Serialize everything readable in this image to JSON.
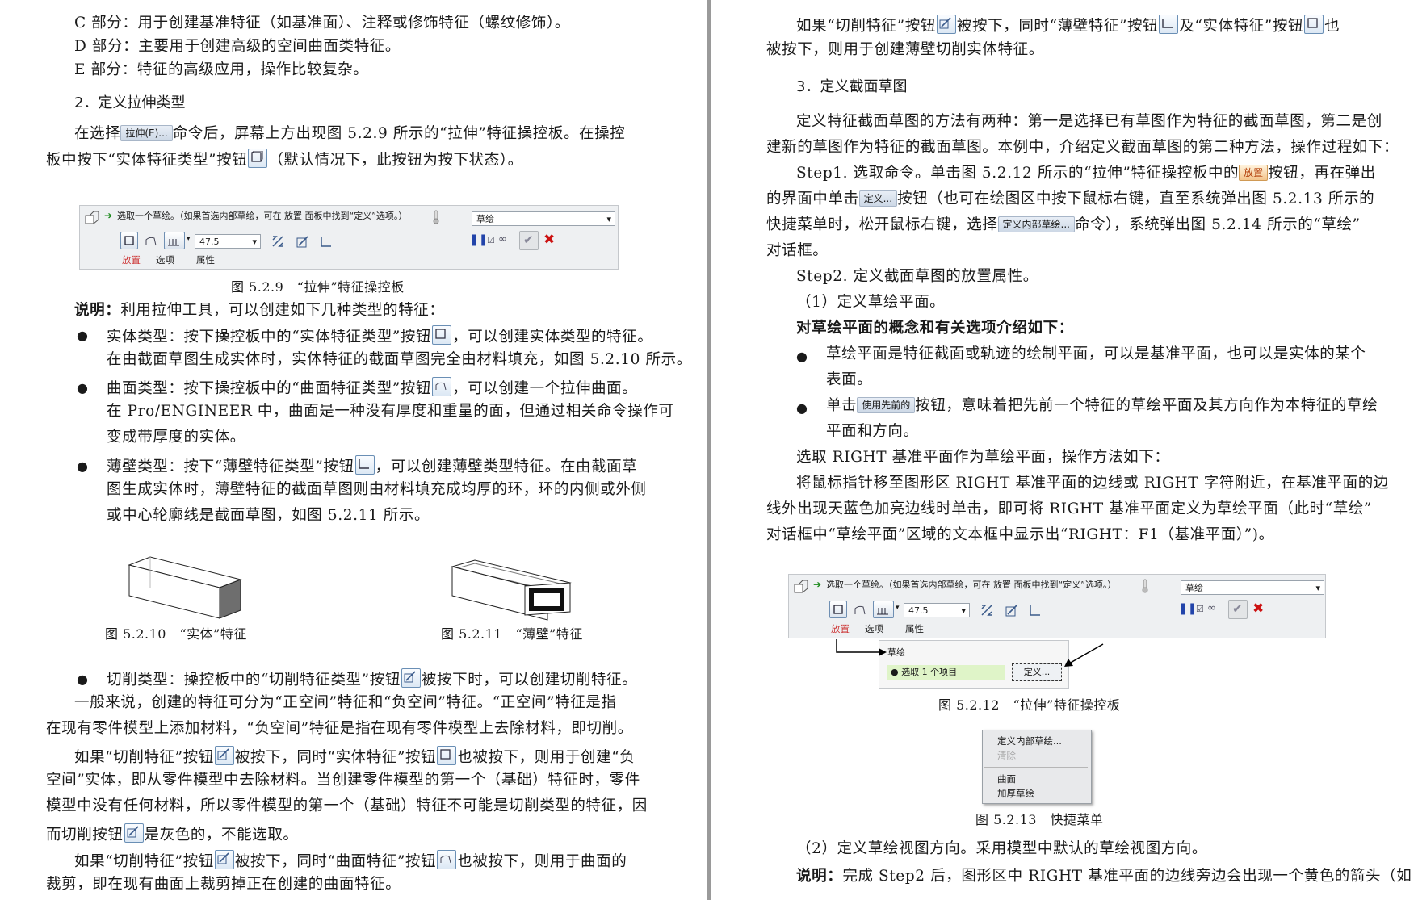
{
  "left": {
    "lines": [
      "C 部分：用于创建基准特征（如基准面）、注释或修饰特征（螺纹修饰）。",
      "D 部分：主要用于创建高级的空间曲面类特征。",
      "E 部分：特征的高级应用，操作比较复杂。"
    ],
    "heading2": "2．定义拉伸类型",
    "p1a_pre": "在选择",
    "p1a_btn": "拉伸(E)...",
    "p1a_post": "命令后，屏幕上方出现图 5.2.9 所示的“拉伸”特征操控板。在操控",
    "p1b_pre": "板中按下“实体特征类型”按钮",
    "p1b_post": "（默认情况下，此按钮为按下状态）。",
    "toolbar1": {
      "msg": "选取一个草绘。（如果首选内部草绘，可在 放置 面板中找到“定义”选项。）",
      "combo_right": "草绘",
      "depth": "47.5",
      "tab_place": "放置",
      "tab_options": "选项",
      "tab_props": "属性"
    },
    "cap529": "图 5.2.9　“拉伸”特征操控板",
    "note_label": "说明：",
    "note_text": "利用拉伸工具，可以创建如下几种类型的特征：",
    "b1a_pre": "实体类型：按下操控板中的“实体特征类型”按钮",
    "b1a_post": "，可以创建实体类型的特征。",
    "b1b": "在由截面草图生成实体时，实体特征的截面草图完全由材料填充，如图 5.2.10 所示。",
    "b2a_pre": "曲面类型：按下操控板中的“曲面特征类型”按钮",
    "b2a_post": "，可以创建一个拉伸曲面。",
    "b2b": "在 Pro/ENGINEER 中，曲面是一种没有厚度和重量的面，但通过相关命令操作可",
    "b2c": "变成带厚度的实体。",
    "b3a_pre": "薄壁类型：按下“薄壁特征类型”按钮",
    "b3a_post": "，可以创建薄壁类型特征。在由截面草",
    "b3b": "图生成实体时，薄壁特征的截面草图则由材料填充成均厚的环，环的内侧或外侧",
    "b3c": "或中心轮廓线是截面草图，如图 5.2.11 所示。",
    "cap5210": "图 5.2.10　“实体”特征",
    "cap5211": "图 5.2.11　“薄壁”特征",
    "b4_pre": "切削类型：操控板中的“切削特征类型”按钮",
    "b4_post": "被按下时，可以创建切削特征。",
    "p2a": "一般来说，创建的特征可分为“正空间”特征和“负空间”特征。“正空间”特征是指",
    "p2b": "在现有零件模型上添加材料，“负空间”特征是指在现有零件模型上去除材料，即切削。",
    "p3a_pre": "如果“切削特征”按钮",
    "p3a_mid": "被按下，同时“实体特征”按钮",
    "p3a_post": "也被按下，则用于创建“负",
    "p3b": "空间”实体，即从零件模型中去除材料。当创建零件模型的第一个（基础）特征时，零件",
    "p3c": "模型中没有任何材料，所以零件模型的第一个（基础）特征不可能是切削类型的特征，因",
    "p3d_pre": "而切削按钮",
    "p3d_post": "是灰色的，不能选取。",
    "p4a_pre": "如果“切削特征”按钮",
    "p4a_mid": "被按下，同时“曲面特征”按钮",
    "p4a_post": "也被按下，则用于曲面的",
    "p4b": "裁剪，即在现有曲面上裁剪掉正在创建的曲面特征。"
  },
  "right": {
    "r1a_pre": "如果“切削特征”按钮",
    "r1a_mid1": "被按下，同时“薄壁特征”按钮",
    "r1a_mid2": "及“实体特征”按钮",
    "r1a_post": "也",
    "r1b": "被按下，则用于创建薄壁切削实体特征。",
    "heading3": "3．定义截面草图",
    "p1a": "定义特征截面草图的方法有两种：第一是选择已有草图作为特征的截面草图，第二是创",
    "p1b": "建新的草图作为特征的截面草图。本例中，介绍定义截面草图的第二种方法，操作过程如下：",
    "s1a_pre": "Step1. 选取命令。单击图 5.2.12 所示的“拉伸”特征操控板中的",
    "s1a_btn": "放置",
    "s1a_post": "按钮，再在弹出",
    "s1b_pre": "的界面中单击",
    "s1b_btn": "定义...",
    "s1b_post": "按钮（也可在绘图区中按下鼠标右键，直至系统弹出图 5.2.13 所示的",
    "s1c_pre": "快捷菜单时，松开鼠标右键，选择",
    "s1c_btn": "定义内部草绘...",
    "s1c_post": "命令），系统弹出图 5.2.14 所示的“草绘”",
    "s1d": "对话框。",
    "s2": "Step2. 定义截面草图的放置属性。",
    "s2_1": "（1）定义草绘平面。",
    "bold_intro": "对草绘平面的概念和有关选项介绍如下：",
    "bl1a": "草绘平面是特征截面或轨迹的绘制平面，可以是基准平面，也可以是实体的某个",
    "bl1b": "表面。",
    "bl2a_pre": "单击",
    "bl2a_btn": "使用先前的",
    "bl2a_post": "按钮，意味着把先前一个特征的草绘平面及其方向作为本特征的草绘",
    "bl2b": "平面和方向。",
    "p2": "选取 RIGHT 基准平面作为草绘平面，操作方法如下：",
    "p3a": "将鼠标指针移至图形区 RIGHT 基准平面的边线或 RIGHT 字符附近，在基准平面的边",
    "p3b": "线外出现天蓝色加亮边线时单击，即可将 RIGHT 基准平面定义为草绘平面（此时“草绘”",
    "p3c": "对话框中“草绘平面”区域的文本框中显示出“RIGHT：F1（基准平面）”)。",
    "toolbar2": {
      "msg": "选取一个草绘。（如果首选内部草绘，可在 放置 面板中找到“定义”选项。）",
      "combo_right": "草绘",
      "depth": "47.5",
      "tab_place": "放置",
      "tab_options": "选项",
      "tab_props": "属性",
      "panel_title": "草绘",
      "panel_select": "● 选取 1 个项目",
      "panel_define": "定义..."
    },
    "cap5212": "图 5.2.12　“拉伸”特征操控板",
    "menu": [
      "定义内部草绘...",
      "清除",
      "曲面",
      "加厚草绘"
    ],
    "cap5213": "图 5.2.13　快捷菜单",
    "s2_2": "（2）定义草绘视图方向。采用模型中默认的草绘视图方向。",
    "last_label": "说明：",
    "last_text": "完成 Step2 后，图形区中 RIGHT 基准平面的边线旁边会出现一个黄色的箭头（如"
  }
}
